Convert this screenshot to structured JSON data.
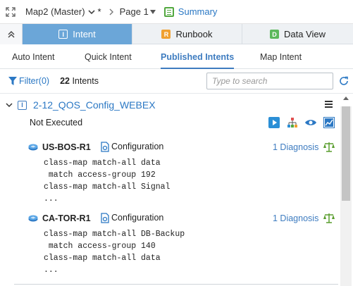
{
  "breadcrumb": {
    "map_name": "Map2 (Master)",
    "modified_marker": "*",
    "page_name": "Page 1",
    "summary_label": "Summary"
  },
  "tabs": [
    {
      "label": "Intent",
      "badge": "I",
      "badge_color": "#ffffff",
      "active": true
    },
    {
      "label": "Runbook",
      "badge": "R",
      "badge_color": "#f0a030",
      "active": false
    },
    {
      "label": "Data View",
      "badge": "D",
      "badge_color": "#5cb85c",
      "active": false
    }
  ],
  "subtabs": [
    "Auto Intent",
    "Quick Intent",
    "Published Intents",
    "Map Intent"
  ],
  "active_subtab": "Published Intents",
  "filter": {
    "label": "Filter(0)",
    "count": "22",
    "count_suffix": " Intents",
    "search_placeholder": "Type to search"
  },
  "intent": {
    "badge": "I",
    "title": "2-12_QOS_Config_WEBEX",
    "status": "Not Executed",
    "devices": [
      {
        "name": "US-BOS-R1",
        "config_label": "Configuration",
        "diagnosis": "1 Diagnosis",
        "config_lines": "class-map match-all data\n match access-group 192\nclass-map match-all Signal\n..."
      },
      {
        "name": "CA-TOR-R1",
        "config_label": "Configuration",
        "diagnosis": "1 Diagnosis",
        "config_lines": "class-map match-all DB-Backup\n match access-group 140\nclass-map match-all data\n..."
      }
    ]
  },
  "colors": {
    "accent": "#2b78c4",
    "active_tab": "#6ba6d8",
    "summary_icon": "#52a83f",
    "scale_icon": "#5a9e2f"
  }
}
